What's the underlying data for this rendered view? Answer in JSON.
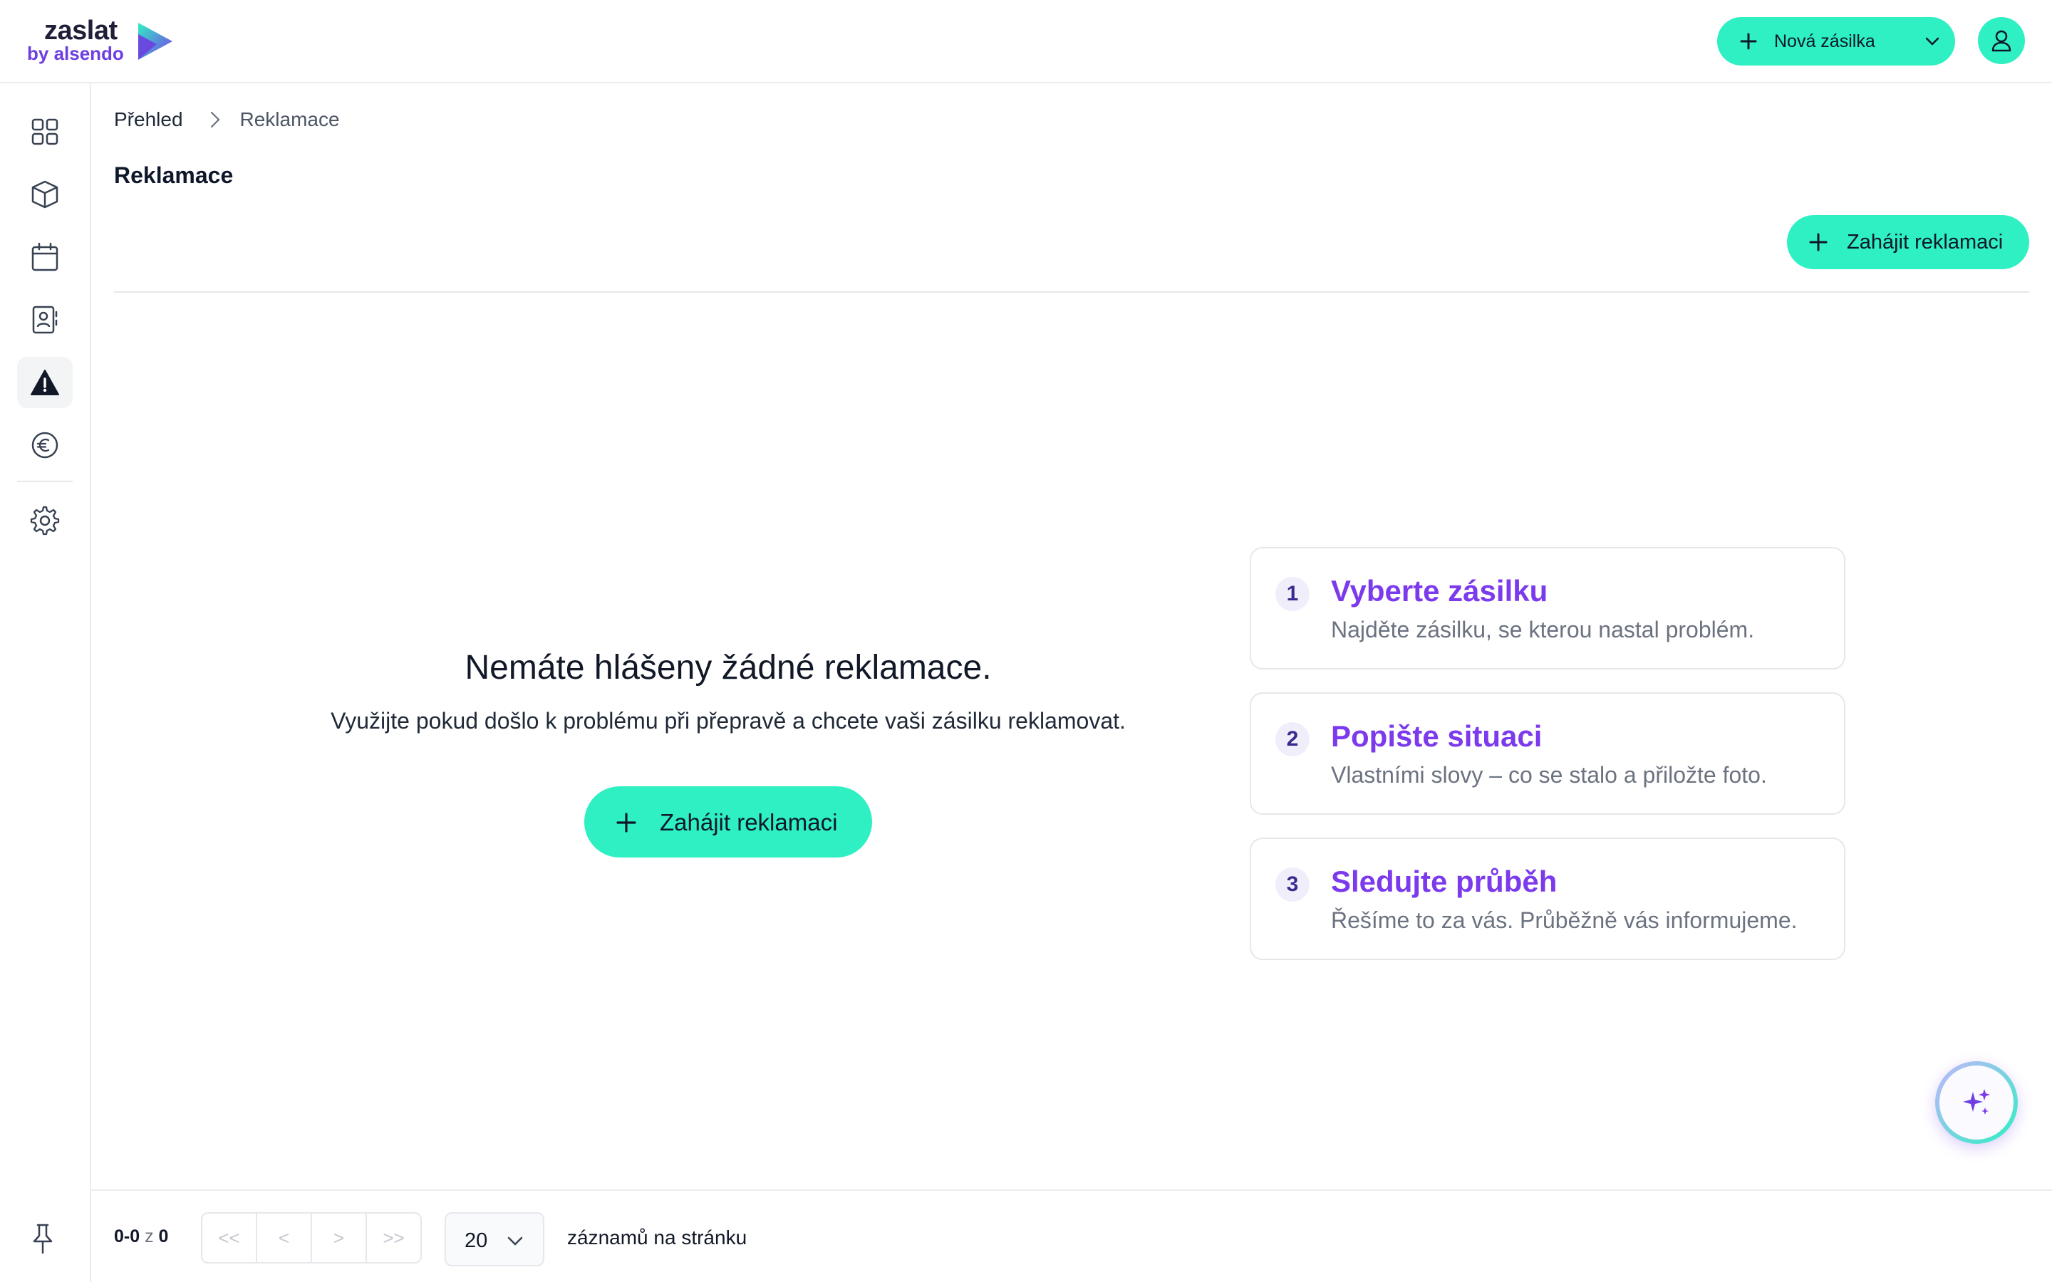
{
  "brand": {
    "name": "zaslat",
    "tagline": "by alsendo",
    "colors": {
      "accent": "#2ef0c3",
      "brand_purple": "#7c3aed",
      "dark": "#1f1f3a"
    }
  },
  "header": {
    "new_shipment_label": "Nová zásilka",
    "user_icon": "user-icon"
  },
  "sidebar": {
    "items": [
      {
        "icon": "dashboard-grid-icon"
      },
      {
        "icon": "package-box-icon"
      },
      {
        "icon": "calendar-icon"
      },
      {
        "icon": "address-book-icon"
      },
      {
        "icon": "warning-triangle-icon",
        "active": true
      },
      {
        "icon": "euro-icon"
      },
      {
        "icon": "settings-gear-icon"
      }
    ],
    "pin_icon": "pin-icon"
  },
  "breadcrumb": {
    "home": "Přehled",
    "current": "Reklamace"
  },
  "page": {
    "title": "Reklamace",
    "start_claim_label": "Zahájit reklamaci"
  },
  "empty_state": {
    "title": "Nemáte hlášeny žádné reklamace.",
    "subtitle": "Využijte pokud došlo k problému při přepravě a chcete vaši zásilku reklamovat.",
    "button_label": "Zahájit reklamaci"
  },
  "steps": [
    {
      "number": "1",
      "title": "Vyberte zásilku",
      "description": "Najděte zásilku, se kterou nastal problém."
    },
    {
      "number": "2",
      "title": "Popište situaci",
      "description": "Vlastními slovy – co se stalo a přiložte foto."
    },
    {
      "number": "3",
      "title": "Sledujte průběh",
      "description": "Řešíme to za vás. Průběžně vás informujeme."
    }
  ],
  "pagination": {
    "range": "0-0",
    "of_label": "z",
    "total": "0",
    "first": "<<",
    "prev": "<",
    "next": ">",
    "last": ">>",
    "page_size": "20",
    "per_page_label": "záznamů na stránku"
  },
  "assistant_fab": {
    "icon": "sparkles-icon"
  }
}
